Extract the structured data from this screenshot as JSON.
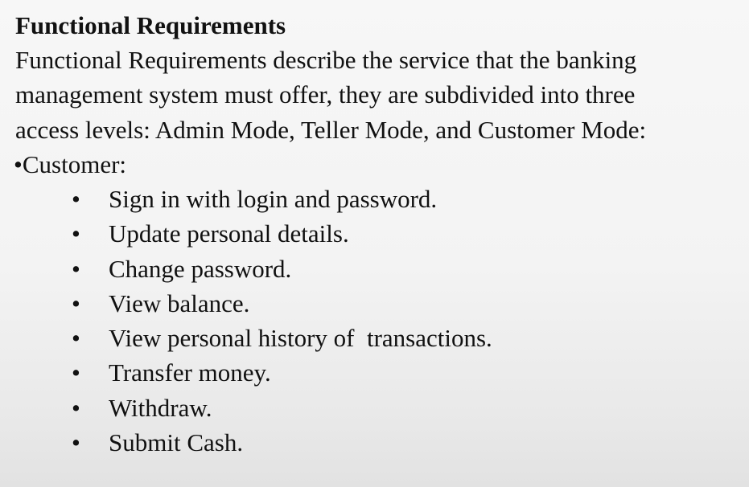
{
  "slide": {
    "title": "Functional Requirements",
    "paragraph_lines": [
      "Functional Requirements describe the service that the banking",
      "management system must offer, they are subdivided into three",
      "access levels: Admin Mode, Teller Mode, and Customer Mode:"
    ],
    "section_label": "•Customer:",
    "bullet_glyph": "•",
    "items": [
      "Sign in with login and password.",
      "Update personal details.",
      "Change password.",
      "View balance.",
      "View personal history of  transactions.",
      "Transfer money.",
      "Withdraw.",
      "Submit Cash."
    ]
  }
}
